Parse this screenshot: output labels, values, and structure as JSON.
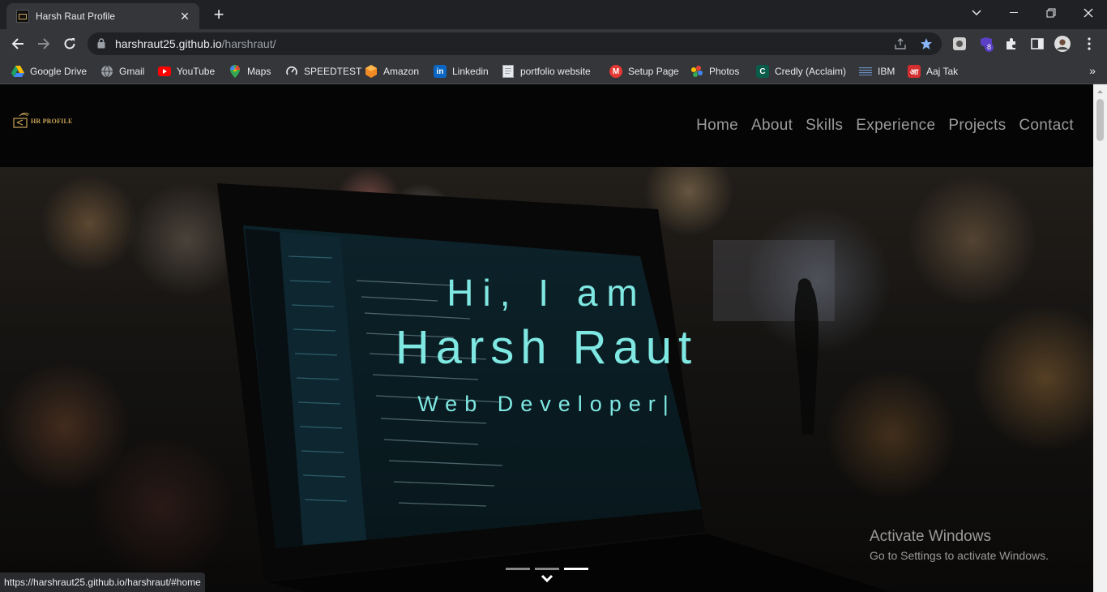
{
  "browser": {
    "tab_title": "Harsh Raut Profile",
    "url_domain": "harshraut25.github.io",
    "url_path": "/harshraut/",
    "extension_badge": "8",
    "bookmarks": [
      {
        "label": "Google Drive",
        "icon": "google-drive-icon"
      },
      {
        "label": "Gmail",
        "icon": "globe-icon"
      },
      {
        "label": "YouTube",
        "icon": "youtube-icon"
      },
      {
        "label": "Maps",
        "icon": "maps-icon"
      },
      {
        "label": "SPEEDTEST",
        "icon": "speedtest-icon"
      },
      {
        "label": "Amazon",
        "icon": "amazon-icon"
      },
      {
        "label": "Linkedin",
        "icon": "linkedin-icon"
      },
      {
        "label": "portfolio website",
        "icon": "page-icon"
      },
      {
        "label": "Setup Page",
        "icon": "setup-icon"
      },
      {
        "label": "Photos",
        "icon": "photos-icon"
      },
      {
        "label": "Credly (Acclaim)",
        "icon": "credly-icon"
      },
      {
        "label": "IBM",
        "icon": "ibm-icon"
      },
      {
        "label": "Aaj Tak",
        "icon": "aajtak-icon"
      }
    ],
    "status_url": "https://harshraut25.github.io/harshraut/#home"
  },
  "site": {
    "logo_text": "HR PROFILE",
    "nav": [
      "Home",
      "About",
      "Skills",
      "Experience",
      "Projects",
      "Contact"
    ],
    "hero": {
      "line1": "Hi, I am",
      "line2": "Harsh Raut",
      "line3": "Web Developer|"
    },
    "carousel": {
      "count": 3,
      "active_index": 2
    }
  },
  "os": {
    "activation_title": "Activate Windows",
    "activation_subtitle": "Go to Settings to activate Windows."
  },
  "colors": {
    "accent": "#7fe8e2",
    "nav_text": "#9b9b9b",
    "logo": "#c9a45a",
    "chrome_dark": "#202124",
    "chrome_mid": "#35363a"
  }
}
